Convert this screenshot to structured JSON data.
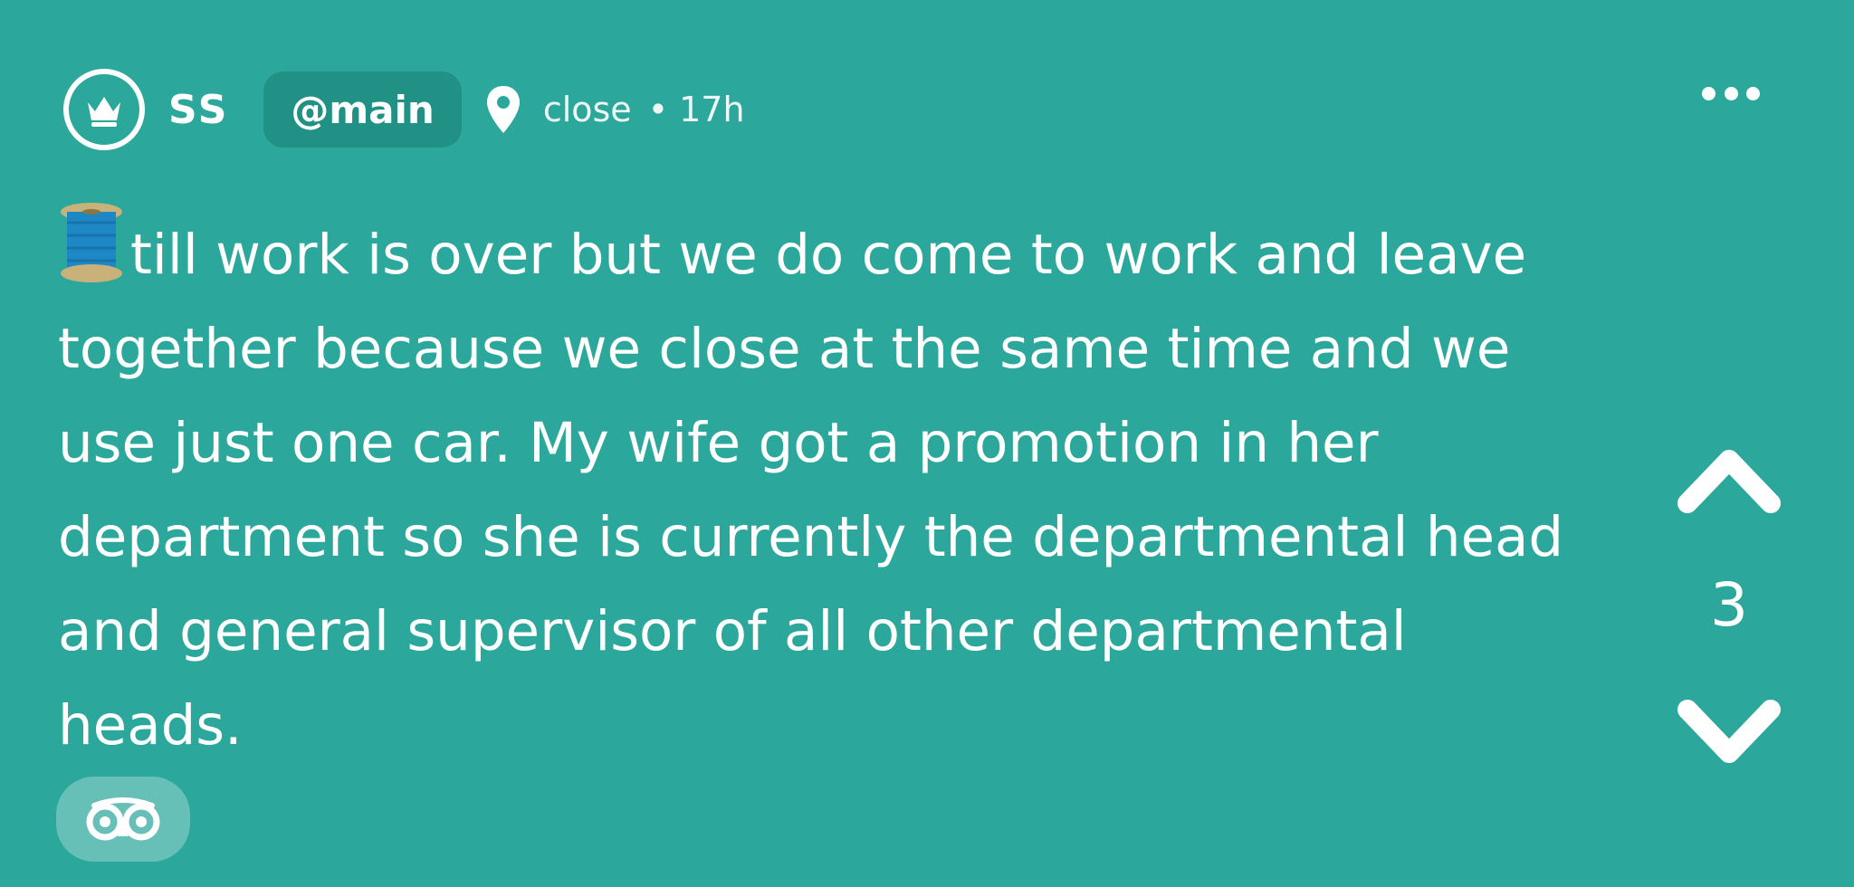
{
  "post": {
    "author": {
      "name": "SS",
      "avatar_icon": "crown-icon"
    },
    "community": "@main",
    "location_icon": "map-pin-icon",
    "location": "close",
    "separator": "•",
    "time_ago": "17h",
    "more_icon": "ellipsis-icon",
    "body_leading_icon": "thread-spool-emoji",
    "body": "till work is over but we do come to work and leave together because we close at the same time and we use just one car. My wife got a promotion in her department so she is currently the departmental head and general supervisor of all other departmental heads.",
    "votes": {
      "up_icon": "chevron-up-icon",
      "count": "3",
      "down_icon": "chevron-down-icon"
    },
    "awards_icon": "owl-eyes-icon"
  },
  "colors": {
    "background": "#2ba89b",
    "pill": "#229185",
    "text": "#ffffff"
  }
}
